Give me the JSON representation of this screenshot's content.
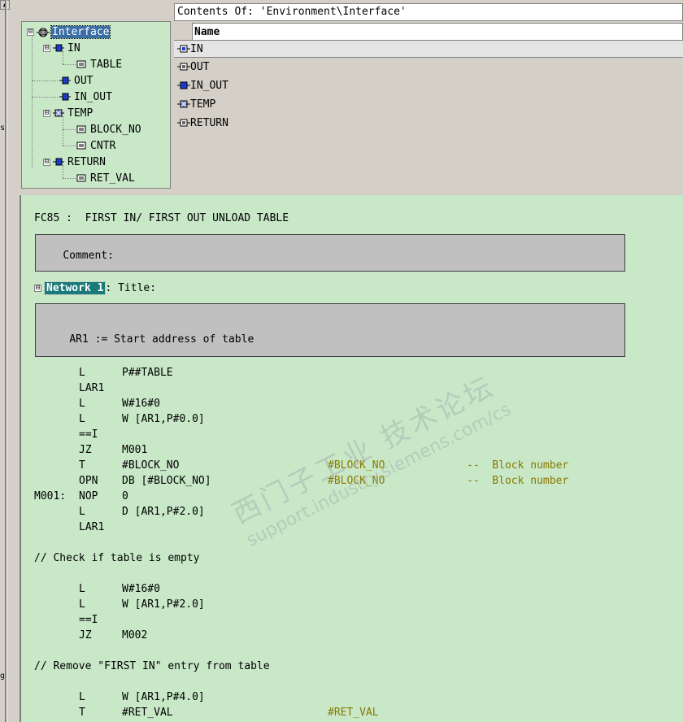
{
  "left_strip": {
    "scroll_up_glyph": "▲",
    "marks": [
      "s",
      "g"
    ]
  },
  "tree": {
    "nodes": [
      {
        "label": "Interface",
        "icon": "interface-icon",
        "expander": "⊟"
      },
      {
        "label": "IN",
        "icon": "in-param-icon",
        "expander": "⊟"
      },
      {
        "label": "TABLE",
        "icon": "variable-icon",
        "expander": ""
      },
      {
        "label": "OUT",
        "icon": "out-param-icon",
        "expander": ""
      },
      {
        "label": "IN_OUT",
        "icon": "inout-param-icon",
        "expander": ""
      },
      {
        "label": "TEMP",
        "icon": "temp-param-icon",
        "expander": "⊟"
      },
      {
        "label": "BLOCK_NO",
        "icon": "variable-icon",
        "expander": ""
      },
      {
        "label": "CNTR",
        "icon": "variable-icon",
        "expander": ""
      },
      {
        "label": "RETURN",
        "icon": "return-param-icon",
        "expander": "⊟"
      },
      {
        "label": "RET_VAL",
        "icon": "variable-icon",
        "expander": ""
      }
    ]
  },
  "contents": {
    "title": "Contents Of: 'Environment\\Interface'",
    "column_header": "Name",
    "rows": [
      {
        "label": "IN",
        "icon": "in-param-icon"
      },
      {
        "label": "OUT",
        "icon": "out-param-icon"
      },
      {
        "label": "IN_OUT",
        "icon": "inout-param-icon"
      },
      {
        "label": "TEMP",
        "icon": "temp-param-icon"
      },
      {
        "label": "RETURN",
        "icon": "return-param-icon"
      }
    ]
  },
  "editor": {
    "block_title": "FC85 :  FIRST IN/ FIRST OUT UNLOAD TABLE",
    "block_comment": "Comment:",
    "network_expander": "⊟",
    "network_label": "Network 1",
    "network_title": ": Title:",
    "network_comment": "AR1 := Start address of table",
    "code": [
      {
        "lbl": "",
        "op": "L",
        "arg": "P##TABLE",
        "sym": "",
        "cmt": ""
      },
      {
        "lbl": "",
        "op": "LAR1",
        "arg": "",
        "sym": "",
        "cmt": ""
      },
      {
        "lbl": "",
        "op": "L",
        "arg": "W#16#0",
        "sym": "",
        "cmt": ""
      },
      {
        "lbl": "",
        "op": "L",
        "arg": "W [AR1,P#0.0]",
        "sym": "",
        "cmt": ""
      },
      {
        "lbl": "",
        "op": "==I",
        "arg": "",
        "sym": "",
        "cmt": ""
      },
      {
        "lbl": "",
        "op": "JZ",
        "arg": "M001",
        "sym": "",
        "cmt": ""
      },
      {
        "lbl": "",
        "op": "T",
        "arg": "#BLOCK_NO",
        "sym": "#BLOCK_NO",
        "cmt": "--  Block number"
      },
      {
        "lbl": "",
        "op": "OPN",
        "arg": "DB [#BLOCK_NO]",
        "sym": "#BLOCK_NO",
        "cmt": "--  Block number"
      },
      {
        "lbl": "M001:",
        "op": "NOP",
        "arg": "0",
        "sym": "",
        "cmt": ""
      },
      {
        "lbl": "",
        "op": "L",
        "arg": "D [AR1,P#2.0]",
        "sym": "",
        "cmt": ""
      },
      {
        "lbl": "",
        "op": "LAR1",
        "arg": "",
        "sym": "",
        "cmt": ""
      },
      {
        "full": ""
      },
      {
        "full": "// Check if table is empty"
      },
      {
        "full": ""
      },
      {
        "lbl": "",
        "op": "L",
        "arg": "W#16#0",
        "sym": "",
        "cmt": ""
      },
      {
        "lbl": "",
        "op": "L",
        "arg": "W [AR1,P#2.0]",
        "sym": "",
        "cmt": ""
      },
      {
        "lbl": "",
        "op": "==I",
        "arg": "",
        "sym": "",
        "cmt": ""
      },
      {
        "lbl": "",
        "op": "JZ",
        "arg": "M002",
        "sym": "",
        "cmt": ""
      },
      {
        "full": ""
      },
      {
        "full": "// Remove \"FIRST IN\" entry from table"
      },
      {
        "full": ""
      },
      {
        "lbl": "",
        "op": "L",
        "arg": "W [AR1,P#4.0]",
        "sym": "",
        "cmt": ""
      },
      {
        "lbl": "",
        "op": "T",
        "arg": "#RET_VAL",
        "sym": "#RET_VAL",
        "cmt": ""
      }
    ]
  },
  "watermark": {
    "line1": "西门子工业  技术论坛",
    "line2": "support.industry.siemens.com/cs"
  },
  "colors": {
    "tree_bg": "#c8e8c8",
    "editor_bg": "#c8e8c8",
    "selection": "#3a6ea5",
    "network_label_bg": "#1a7a7a",
    "symbol_text": "#8a7a00"
  }
}
